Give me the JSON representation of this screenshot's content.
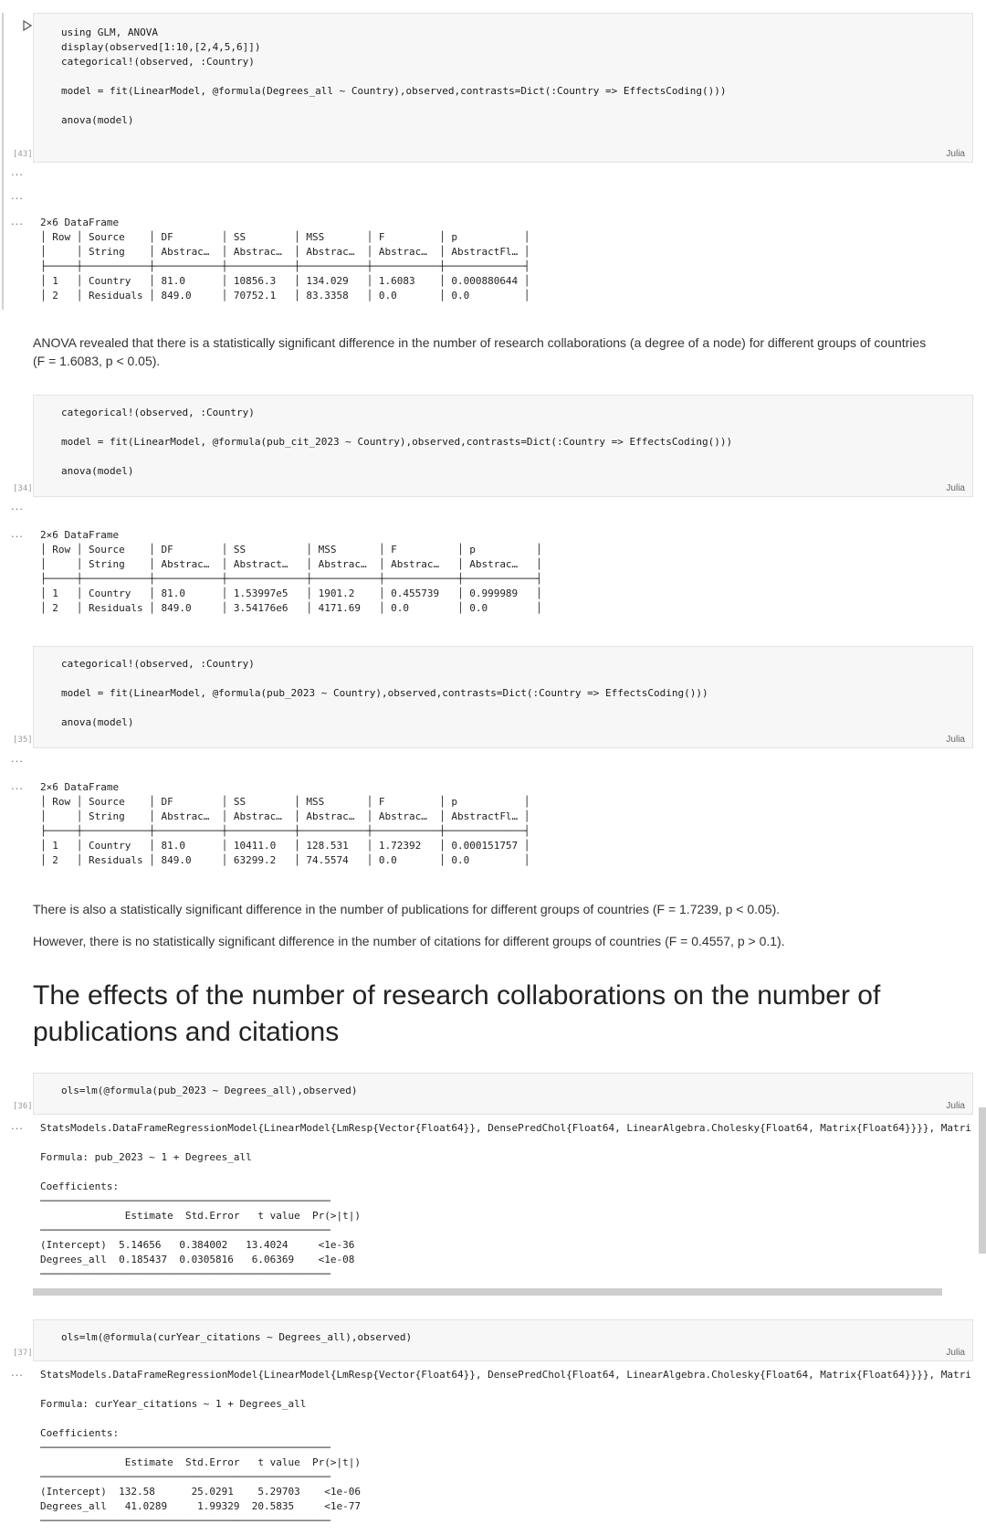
{
  "lang_label": "Julia",
  "ellipsis": "...",
  "cells": [
    {
      "exec": "[43]",
      "lines": [
        "using GLM, ANOVA",
        "display(observed[1:10,[2,4,5,6]])",
        "categorical!(observed, :Country)",
        "",
        "model = fit(LinearModel, @formula(Degrees_all ~ Country),observed,contrasts=Dict(:Country => EffectsCoding()))",
        "",
        "anova(model)"
      ]
    },
    {
      "exec": "[34]",
      "lines": [
        "categorical!(observed, :Country)",
        "",
        "model = fit(LinearModel, @formula(pub_cit_2023 ~ Country),observed,contrasts=Dict(:Country => EffectsCoding()))",
        "",
        "anova(model)"
      ]
    },
    {
      "exec": "[35]",
      "lines": [
        "categorical!(observed, :Country)",
        "",
        "model = fit(LinearModel, @formula(pub_2023 ~ Country),observed,contrasts=Dict(:Country => EffectsCoding()))",
        "",
        "anova(model)"
      ]
    },
    {
      "exec": "[36]",
      "lines": [
        "ols=lm(@formula(pub_2023 ~ Degrees_all),observed)"
      ]
    },
    {
      "exec": "[37]",
      "lines": [
        "ols=lm(@formula(curYear_citations ~ Degrees_all),observed)"
      ]
    }
  ],
  "outputs": {
    "anova1": [
      "2×6 DataFrame",
      "│ Row │ Source    │ DF        │ SS        │ MSS       │ F         │ p           │",
      "│     │ String    │ Abstrac…  │ Abstrac…  │ Abstrac…  │ Abstrac…  │ AbstractFl… │",
      "├─────┼───────────┼───────────┼───────────┼───────────┼───────────┼─────────────┤",
      "│ 1   │ Country   │ 81.0      │ 10856.3   │ 134.029   │ 1.6083    │ 0.000880644 │",
      "│ 2   │ Residuals │ 849.0     │ 70752.1   │ 83.3358   │ 0.0       │ 0.0         │"
    ],
    "anova2": [
      "2×6 DataFrame",
      "│ Row │ Source    │ DF        │ SS          │ MSS       │ F          │ p          │",
      "│     │ String    │ Abstrac…  │ Abstract…   │ Abstrac…  │ Abstrac…   │ Abstrac…   │",
      "├─────┼───────────┼───────────┼─────────────┼───────────┼────────────┼────────────┤",
      "│ 1   │ Country   │ 81.0      │ 1.53997e5   │ 1901.2    │ 0.455739   │ 0.999989   │",
      "│ 2   │ Residuals │ 849.0     │ 3.54176e6   │ 4171.69   │ 0.0        │ 0.0        │"
    ],
    "anova3": [
      "2×6 DataFrame",
      "│ Row │ Source    │ DF        │ SS        │ MSS       │ F         │ p           │",
      "│     │ String    │ Abstrac…  │ Abstrac…  │ Abstrac…  │ Abstrac…  │ AbstractFl… │",
      "├─────┼───────────┼───────────┼───────────┼───────────┼───────────┼─────────────┤",
      "│ 1   │ Country   │ 81.0      │ 10411.0   │ 128.531   │ 1.72392   │ 0.000151757 │",
      "│ 2   │ Residuals │ 849.0     │ 63299.2   │ 74.5574   │ 0.0       │ 0.0         │"
    ],
    "ols1": [
      "StatsModels.DataFrameRegressionModel{LinearModel{LmResp{Vector{Float64}}, DensePredChol{Float64, LinearAlgebra.Cholesky{Float64, Matrix{Float64}}}}, Matrix{Floa",
      "",
      "Formula: pub_2023 ~ 1 + Degrees_all",
      "",
      "Coefficients:",
      "────────────────────────────────────────────────",
      "              Estimate  Std.Error   t value  Pr(>|t|)",
      "────────────────────────────────────────────────",
      "(Intercept)  5.14656   0.384002   13.4024     <1e-36",
      "Degrees_all  0.185437  0.0305816   6.06369    <1e-08",
      "────────────────────────────────────────────────"
    ],
    "ols2": [
      "StatsModels.DataFrameRegressionModel{LinearModel{LmResp{Vector{Float64}}, DensePredChol{Float64, LinearAlgebra.Cholesky{Float64, Matrix{Float64}}}}, Matrix{Floa",
      "",
      "Formula: curYear_citations ~ 1 + Degrees_all",
      "",
      "Coefficients:",
      "────────────────────────────────────────────────",
      "              Estimate  Std.Error   t value  Pr(>|t|)",
      "────────────────────────────────────────────────",
      "(Intercept)  132.58      25.0291    5.29703    <1e-06",
      "Degrees_all   41.0289     1.99329  20.5835     <1e-77",
      "────────────────────────────────────────────────"
    ]
  },
  "markdown": {
    "p1": "ANOVA revealed that there is a statistically significant difference in the number of research collaborations (a degree of a node) for different groups of countries (F = 1.6083, p < 0.05).",
    "p2": "There is also a statistically significant difference in the number of publications for different groups of countries (F = 1.7239, p < 0.05).",
    "p3": "However, there is no statistically significant difference in the number of citations for different groups of countries (F = 0.4557, p > 0.1).",
    "h2": "The effects of the number of research collaborations on the number of publications and citations"
  }
}
